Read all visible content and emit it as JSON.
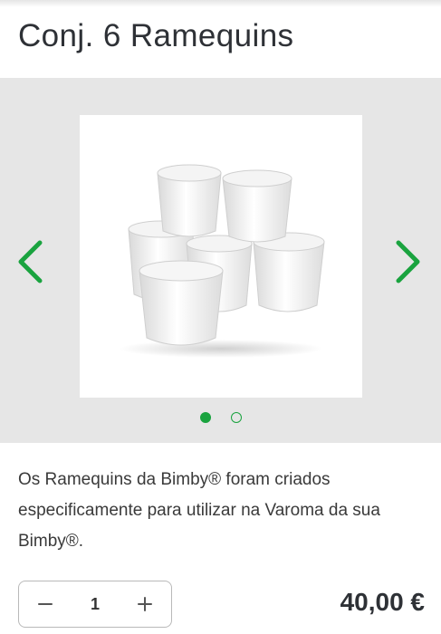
{
  "product": {
    "title": "Conj. 6 Ramequins",
    "image_alt": "white-ramekins-stack",
    "description": "Os Ramequins da Bimby® foram criados especificamente para utilizar na Varoma da sua Bimby®."
  },
  "gallery": {
    "prev_icon": "chevron-left-icon",
    "next_icon": "chevron-right-icon",
    "current_slide": 1,
    "slide_count": 2
  },
  "purchase": {
    "quantity": "1",
    "decrement_icon": "minus-icon",
    "increment_icon": "plus-icon",
    "price": "40,00 €"
  },
  "colors": {
    "accent": "#1aa33f",
    "gallery_bg": "#e6e6e6",
    "text": "#2e3136"
  }
}
